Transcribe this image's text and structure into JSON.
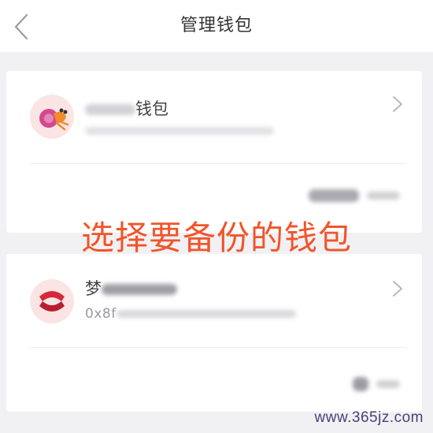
{
  "header": {
    "title": "管理钱包"
  },
  "wallets": [
    {
      "name_suffix": "钱包",
      "address_prefix": "",
      "avatar": "hermit-crab-icon",
      "balance_visible": ""
    },
    {
      "name_prefix": "梦",
      "address_prefix": "0x8f",
      "avatar": "red-shell-icon",
      "balance_visible": ""
    }
  ],
  "overlay": {
    "instruction": "选择要备份的钱包"
  },
  "watermark": "www.365jz.com",
  "colors": {
    "overlay_text": "#f0552b",
    "background": "#f1f1f3",
    "card": "#ffffff"
  }
}
